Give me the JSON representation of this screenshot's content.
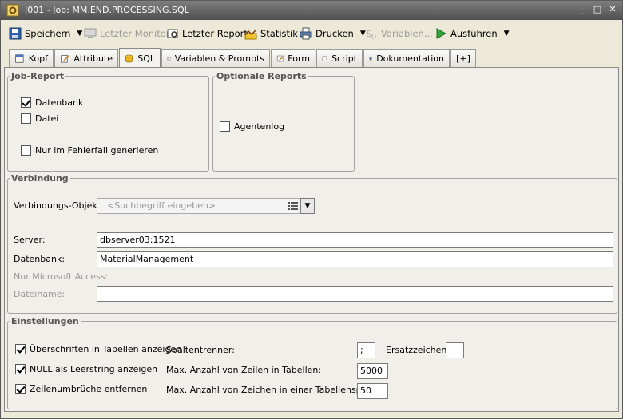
{
  "window": {
    "title": "J001 - Job: MM.END.PROCESSING.SQL"
  },
  "toolbar": {
    "save": "Speichern",
    "last_monitor": "Letzter Monitor",
    "last_report": "Letzter Report",
    "statistics": "Statistik",
    "print": "Drucken",
    "variables": "Variablen...",
    "execute": "Ausführen"
  },
  "tabs": [
    "Kopf",
    "Attribute",
    "SQL",
    "Variablen & Prompts",
    "Form",
    "Script",
    "Dokumentation",
    "[+]"
  ],
  "job_report": {
    "legend": "Job-Report",
    "database": {
      "label": "Datenbank",
      "checked": true
    },
    "file": {
      "label": "Datei",
      "checked": false
    },
    "on_error_only": {
      "label": "Nur im Fehlerfall generieren",
      "checked": false
    }
  },
  "optional_reports": {
    "legend": "Optionale Reports",
    "agentlog": {
      "label": "Agentenlog",
      "checked": false
    }
  },
  "connection": {
    "legend": "Verbindung",
    "object_label": "Verbindungs-Objekt:",
    "object_placeholder": "<Suchbegriff eingeben>",
    "server_label": "Server:",
    "server_value": "dbserver03:1521",
    "database_label": "Datenbank:",
    "database_value": "MaterialManagement",
    "ms_access_label": "Nur Microsoft Access:",
    "filename_label": "Dateiname:",
    "filename_value": ""
  },
  "settings": {
    "legend": "Einstellungen",
    "headers_in_tables": {
      "label": "Überschriften in Tabellen anzeigen",
      "checked": true
    },
    "null_as_empty": {
      "label": "NULL als Leerstring anzeigen",
      "checked": true
    },
    "remove_linebreaks": {
      "label": "Zeilenumbrüche entfernen",
      "checked": true
    },
    "column_separator_label": "Spaltentrenner:",
    "column_separator_value": ";",
    "replacement_label": "Ersatzzeichen:",
    "replacement_value": "",
    "max_rows_label": "Max. Anzahl von Zeilen in Tabellen:",
    "max_rows_value": "5000",
    "max_chars_label": "Max. Anzahl von Zeichen in einer Tabellenspalte:",
    "max_chars_value": "50"
  }
}
